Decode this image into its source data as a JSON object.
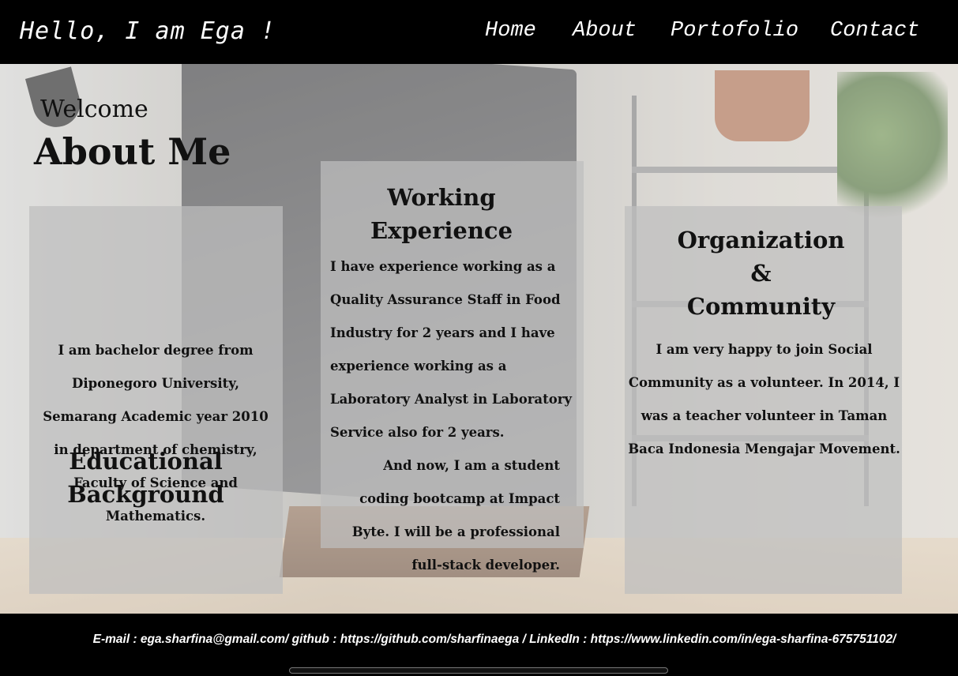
{
  "header": {
    "brand": "Hello, I am Ega !",
    "nav": [
      "Home",
      "About",
      "Portofolio",
      "Contact"
    ]
  },
  "about": {
    "welcome": "Welcome",
    "title": "About Me",
    "education": {
      "title_line1": "Educational",
      "title_line2": "Background",
      "text": "I am bachelor degree from Diponegoro University, Semarang Academic year 2010 in department of chemistry, Faculty of Science and Mathematics."
    },
    "work": {
      "title_line1": "Working",
      "title_line2": "Experience",
      "text1": "I have experience working as a Quality Assurance Staff in Food Industry for 2 years and I have experience working as a Laboratory Analyst in Laboratory Service also for 2 years.",
      "text2": "And now, I am a student coding bootcamp at Impact Byte. I will be a professional full-stack developer."
    },
    "organization": {
      "title_line1": "Organization",
      "title_line2": "&",
      "title_line3": "Community",
      "text": "I am very happy to join Social Community as a volunteer. In 2014, I was a teacher volunteer in Taman Baca Indonesia Mengajar Movement."
    }
  },
  "footer": {
    "contact": "E-mail : ega.sharfina@gmail.com/ github : https://github.com/sharfinaega / LinkedIn : https://www.linkedin.com/in/ega-sharfina-675751102/"
  },
  "colors": {
    "header_bg": "#000000",
    "footer_bg": "#000000",
    "card_bg": "#bebebe"
  }
}
